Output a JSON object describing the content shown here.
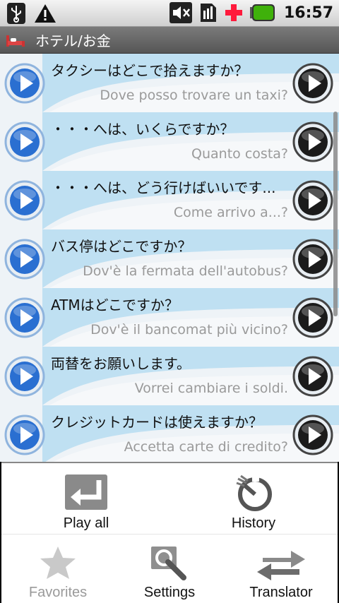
{
  "status_bar": {
    "time": "16:57",
    "left_icons": [
      "usb-icon",
      "warning-icon"
    ],
    "right_icons": [
      "mute-icon",
      "sim-icon",
      "medical-cross-icon",
      "battery-icon"
    ],
    "cross_color": "#ff1a3c",
    "battery_color": "#3fb10b"
  },
  "title_bar": {
    "title": "ホテル/お金",
    "icon": "bed-icon"
  },
  "phrases": [
    {
      "jp": "タクシーはどこで拾えますか？",
      "it": "Dove posso trovare un taxi?"
    },
    {
      "jp": "・・・へは、いくらですか？",
      "it": "Quanto costa?"
    },
    {
      "jp": "・・・へは、どう行けばいいです...",
      "it": "Come arrivo a...?"
    },
    {
      "jp": "バス停はどこですか？",
      "it": "Dov'è la fermata dell'autobus?"
    },
    {
      "jp": "ATMはどこですか？",
      "it": "Dov'è il bancomat più vicino?"
    },
    {
      "jp": "両替をお願いします。",
      "it": "Vorrei cambiare i soldi."
    },
    {
      "jp": "クレジットカードは使えますか？",
      "it": "Accetta carte di credito?"
    }
  ],
  "menu": {
    "play_all": "Play all",
    "history": "History",
    "favorites": "Favorites",
    "settings": "Settings",
    "translator": "Translator"
  },
  "colors": {
    "accent_blue": "#2a6fd1",
    "row_bg": "#d9e6ef",
    "muted_text": "#9a9a9a"
  }
}
